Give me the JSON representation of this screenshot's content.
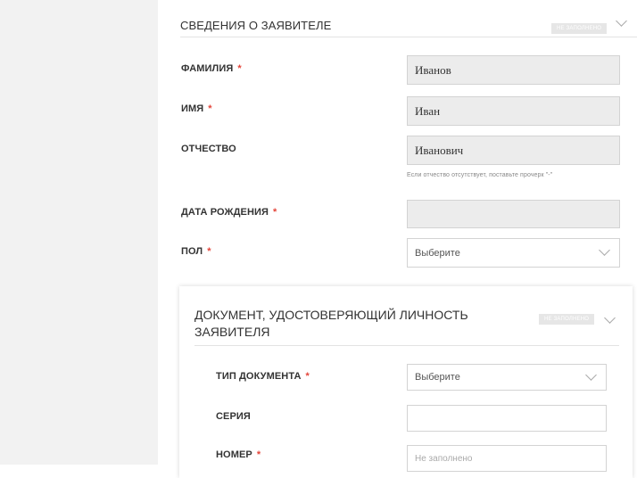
{
  "applicant": {
    "title": "СВЕДЕНИЯ О ЗАЯВИТЕЛЕ",
    "status_badge": "НЕ ЗАПОЛНЕНО",
    "last_name": {
      "label": "ФАМИЛИЯ",
      "value": "Иванов"
    },
    "first_name": {
      "label": "ИМЯ",
      "value": "Иван"
    },
    "patronymic": {
      "label": "ОТЧЕСТВО",
      "value": "Иванович",
      "hint": "Если отчество отсутствует, поставьте прочерк \"-\""
    },
    "birth_date": {
      "label": "ДАТА РОЖДЕНИЯ",
      "value": ""
    },
    "gender": {
      "label": "ПОЛ",
      "selected": "Выберите"
    }
  },
  "identity_document": {
    "title": "ДОКУМЕНТ, УДОСТОВЕРЯЮЩИЙ ЛИЧНОСТЬ ЗАЯВИТЕЛЯ",
    "status_badge": "НЕ ЗАПОЛНЕНО",
    "doc_type": {
      "label": "ТИП ДОКУМЕНТА",
      "selected": "Выберите"
    },
    "series": {
      "label": "СЕРИЯ",
      "value": ""
    },
    "number": {
      "label": "НОМЕР",
      "placeholder": "Не заполнено"
    }
  },
  "required_mark": "*",
  "colors": {
    "required": "#e4453a",
    "field_fill": "#ececec",
    "sidebar": "#f2f2f2"
  }
}
